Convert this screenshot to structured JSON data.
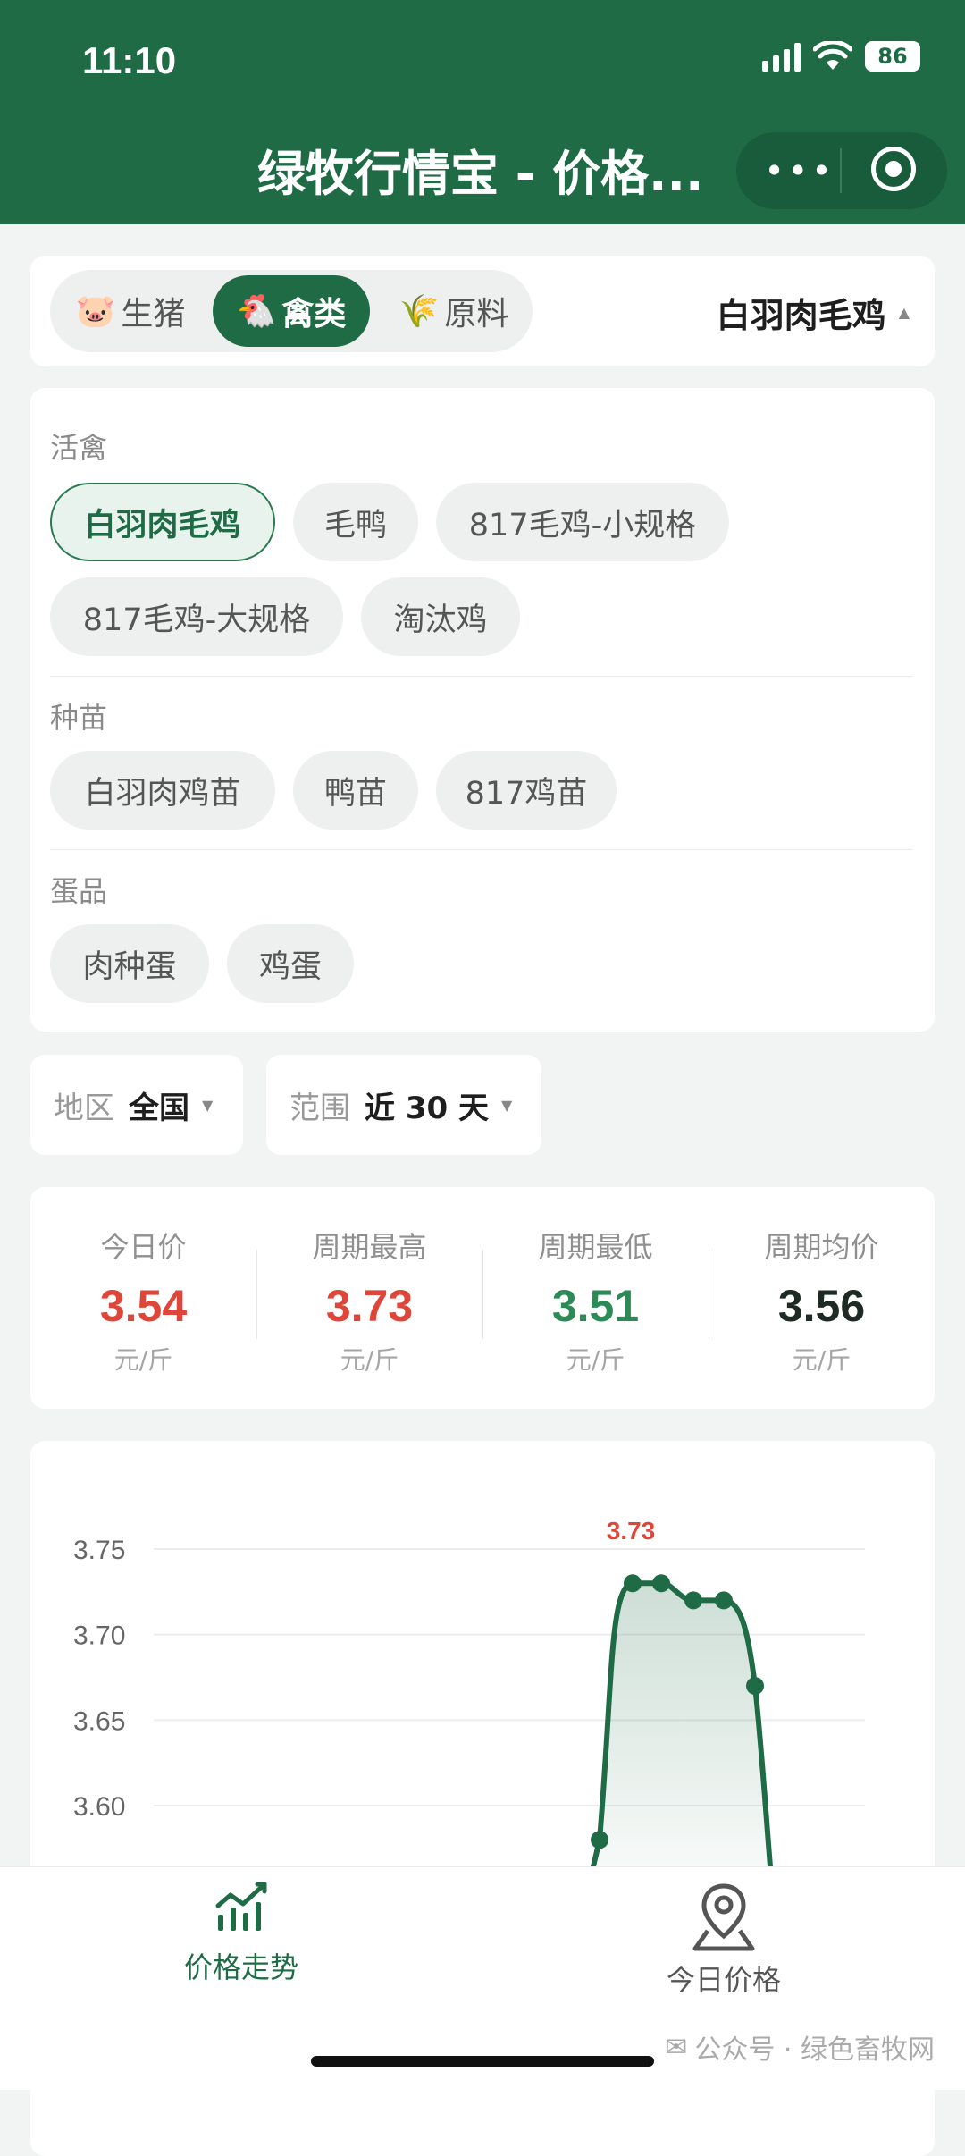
{
  "status_bar": {
    "time": "11:10",
    "battery": "86"
  },
  "header": {
    "title": "绿牧行情宝 - 价格...",
    "menu_icon": "more-dots-icon",
    "close_icon": "target-icon"
  },
  "categories": {
    "items": [
      {
        "emoji": "🐷",
        "label": "生猪"
      },
      {
        "emoji": "🐔",
        "label": "禽类"
      },
      {
        "emoji": "🌾",
        "label": "原料"
      }
    ],
    "active": "禽类",
    "selected_product": "白羽肉毛鸡"
  },
  "products": {
    "sections": [
      {
        "label": "活禽",
        "items": [
          "白羽肉毛鸡",
          "毛鸭",
          "817毛鸡-小规格",
          "817毛鸡-大规格",
          "淘汰鸡"
        ]
      },
      {
        "label": "种苗",
        "items": [
          "白羽肉鸡苗",
          "鸭苗",
          "817鸡苗"
        ]
      },
      {
        "label": "蛋品",
        "items": [
          "肉种蛋",
          "鸡蛋"
        ]
      }
    ],
    "active_item": "白羽肉毛鸡"
  },
  "filters": {
    "region_key": "地区",
    "region_value": "全国",
    "range_key": "范围",
    "range_value": "近 30 天"
  },
  "stats": [
    {
      "label": "今日价",
      "value": "3.54",
      "unit": "元/斤",
      "color": "#e0453a"
    },
    {
      "label": "周期最高",
      "value": "3.73",
      "unit": "元/斤",
      "color": "#e0453a"
    },
    {
      "label": "周期最低",
      "value": "3.51",
      "unit": "元/斤",
      "color": "#2c8a57"
    },
    {
      "label": "周期均价",
      "value": "3.56",
      "unit": "元/斤",
      "color": "#1e2a24"
    }
  ],
  "chart_data": {
    "type": "area",
    "y_ticks": [
      "3.75",
      "3.70",
      "3.65",
      "3.60"
    ],
    "ylim": [
      3.55,
      3.75
    ],
    "points": [
      {
        "y": 3.58
      },
      {
        "y": 3.73
      },
      {
        "y": 3.73
      },
      {
        "y": 3.72
      },
      {
        "y": 3.72
      },
      {
        "y": 3.67
      }
    ],
    "peak_label": "3.73",
    "line_color": "#1f6b45",
    "grid": true
  },
  "bottom_nav": {
    "items": [
      {
        "label": "价格走势",
        "icon": "chart-icon"
      },
      {
        "label": "今日价格",
        "icon": "map-pin-icon"
      }
    ],
    "active": "价格走势"
  },
  "watermark": "公众号 · 绿色畜牧网"
}
